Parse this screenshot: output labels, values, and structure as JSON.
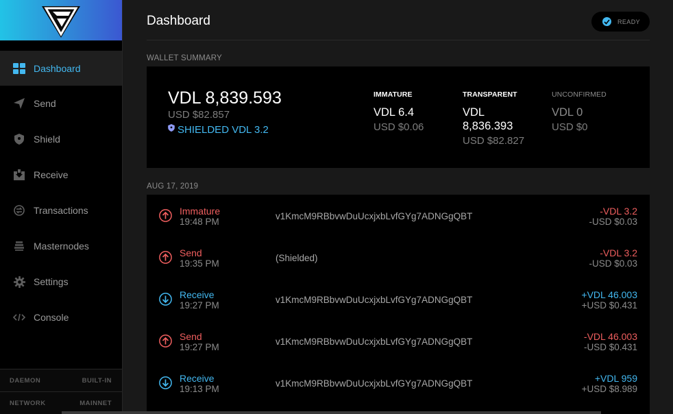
{
  "sidebar": {
    "items": [
      {
        "label": "Dashboard",
        "icon": "dashboard-icon",
        "active": true
      },
      {
        "label": "Send",
        "icon": "send-icon"
      },
      {
        "label": "Shield",
        "icon": "shield-icon"
      },
      {
        "label": "Receive",
        "icon": "receive-icon"
      },
      {
        "label": "Transactions",
        "icon": "transactions-icon"
      },
      {
        "label": "Masternodes",
        "icon": "masternodes-icon"
      },
      {
        "label": "Settings",
        "icon": "settings-icon"
      },
      {
        "label": "Console",
        "icon": "console-icon"
      }
    ],
    "footer": [
      {
        "key": "DAEMON",
        "value": "BUILT-IN"
      },
      {
        "key": "NETWORK",
        "value": "MAINNET"
      }
    ]
  },
  "header": {
    "title": "Dashboard",
    "status": "READY"
  },
  "summary": {
    "section_label": "WALLET SUMMARY",
    "total": "VDL 8,839.593",
    "total_usd": "USD $82.857",
    "shielded": "SHIELDED VDL 3.2",
    "immature": {
      "label": "IMMATURE",
      "value": "VDL 6.4",
      "usd": "USD $0.06"
    },
    "transparent": {
      "label": "TRANSPARENT",
      "value": "VDL 8,836.393",
      "usd": "USD $82.827"
    },
    "unconfirmed": {
      "label": "UNCONFIRMED",
      "value": "VDL 0",
      "usd": "USD $0"
    }
  },
  "transactions": {
    "date_label": "AUG 17, 2019",
    "rows": [
      {
        "type": "Immature",
        "time": "19:48 PM",
        "address": "v1KmcM9RBbvwDuUcxjxbLvfGYg7ADNGgQBT",
        "amount": "-VDL 3.2",
        "usd": "-USD $0.03",
        "direction": "out"
      },
      {
        "type": "Send",
        "time": "19:35 PM",
        "address": "(Shielded)",
        "amount": "-VDL 3.2",
        "usd": "-USD $0.03",
        "direction": "out"
      },
      {
        "type": "Receive",
        "time": "19:27 PM",
        "address": "v1KmcM9RBbvwDuUcxjxbLvfGYg7ADNGgQBT",
        "amount": "+VDL 46.003",
        "usd": "+USD $0.431",
        "direction": "in"
      },
      {
        "type": "Send",
        "time": "19:27 PM",
        "address": "v1KmcM9RBbvwDuUcxjxbLvfGYg7ADNGgQBT",
        "amount": "-VDL 46.003",
        "usd": "-USD $0.431",
        "direction": "out"
      },
      {
        "type": "Receive",
        "time": "19:13 PM",
        "address": "v1KmcM9RBbvwDuUcxjxbLvfGYg7ADNGgQBT",
        "amount": "+VDL 959",
        "usd": "+USD $8.989",
        "direction": "in"
      }
    ]
  },
  "colors": {
    "accent": "#43b8f0",
    "negative": "#ee5e5e",
    "panel": "#000000",
    "background": "#191919"
  }
}
